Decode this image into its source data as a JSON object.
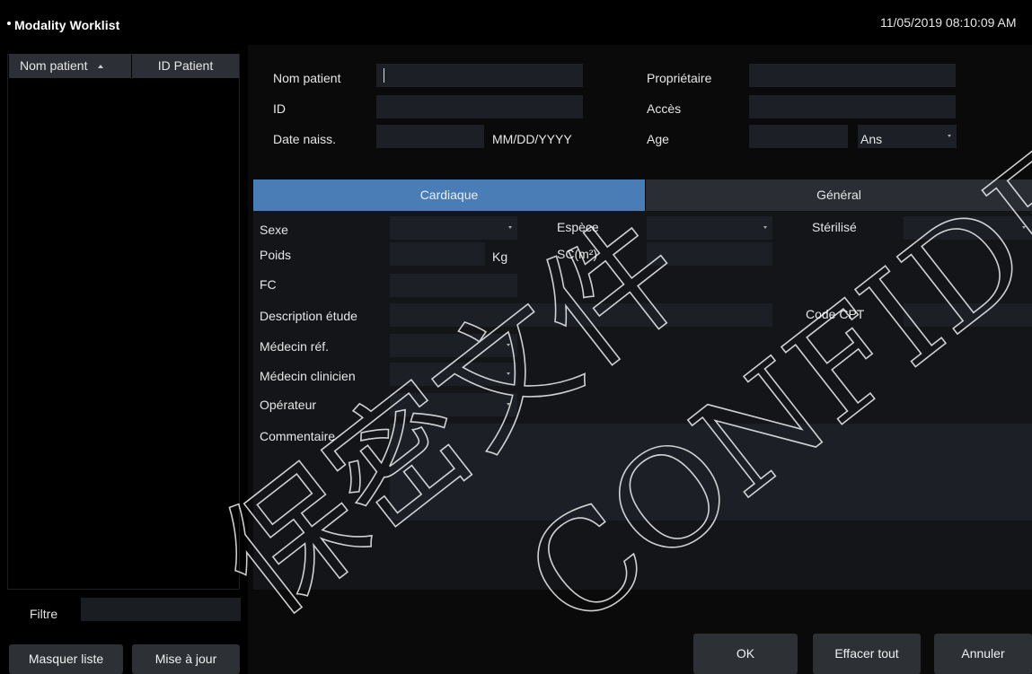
{
  "header": {
    "title": "Modality Worklist",
    "datetime": "11/05/2019 08:10:09 AM"
  },
  "worklist": {
    "columns": [
      "Nom patient",
      "ID Patient"
    ],
    "filter_label": "Filtre",
    "filter_value": "",
    "hide_button": "Masquer liste",
    "update_button": "Mise à jour"
  },
  "patient": {
    "nom_label": "Nom patient",
    "nom_value": "",
    "id_label": "ID",
    "id_value": "",
    "dob_label": "Date naiss.",
    "dob_value": "",
    "dob_format": "MM/DD/YYYY",
    "owner_label": "Propriétaire",
    "owner_value": "",
    "access_label": "Accès",
    "access_value": "",
    "age_label": "Age",
    "age_value": "",
    "age_unit": "Ans"
  },
  "tabs": [
    {
      "label": "Cardiaque",
      "active": true
    },
    {
      "label": "Général",
      "active": false
    }
  ],
  "cardio": {
    "sexe_label": "Sexe",
    "sexe_value": "",
    "espece_label": "Espèce",
    "espece_value": "",
    "sterilise_label": "Stérilisé",
    "sterilise_value": "",
    "poids_label": "Poids",
    "poids_value": "",
    "poids_unit": "Kg",
    "sc_label": "SC(m²)",
    "sc_value": "",
    "fc_label": "FC",
    "fc_value": "",
    "desc_label": "Description étude",
    "desc_value": "",
    "cpt_label": "Code CPT",
    "cpt_value": "",
    "medref_label": "Médecin réf.",
    "medref_value": "",
    "medcli_label": "Médecin clinicien",
    "medcli_value": "",
    "oper_label": "Opérateur",
    "oper_value": "",
    "comment_label": "Commentaire",
    "comment_value": ""
  },
  "actions": {
    "ok": "OK",
    "clear": "Effacer tout",
    "cancel": "Annuler"
  },
  "colors": {
    "active_tab": "#4a7db5",
    "field_bg": "#1c1f25",
    "button_bg": "#2d3035",
    "panel_bg": "#141519"
  },
  "watermark": {
    "chinese": "保密文件",
    "latin": "CONFIDENTIAL"
  }
}
